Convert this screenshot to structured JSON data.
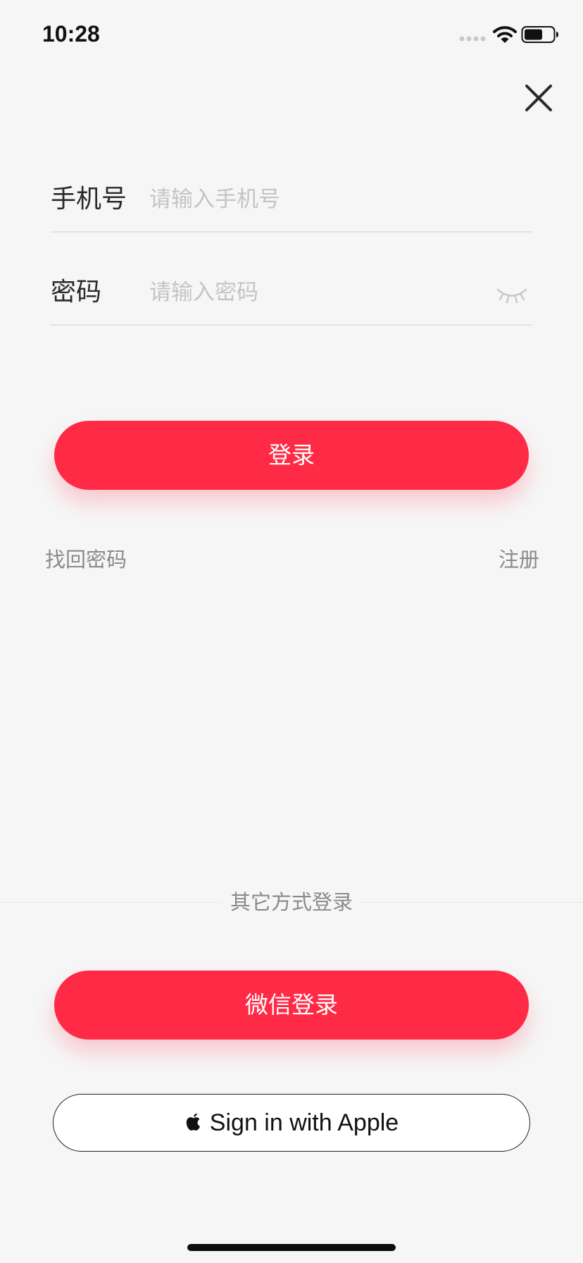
{
  "status_bar": {
    "time": "10:28"
  },
  "form": {
    "phone": {
      "label": "手机号",
      "placeholder": "请输入手机号",
      "value": ""
    },
    "password": {
      "label": "密码",
      "placeholder": "请输入密码",
      "value": ""
    }
  },
  "actions": {
    "login_label": "登录",
    "forgot_password_label": "找回密码",
    "register_label": "注册"
  },
  "alternatives": {
    "divider_label": "其它方式登录",
    "wechat_label": "微信登录",
    "apple_label": "Sign in with Apple"
  },
  "icons": {
    "close": "close-icon",
    "eye": "eye-closed-icon",
    "apple": "apple-logo-icon",
    "wifi": "wifi-icon",
    "battery": "battery-icon",
    "signal": "cellular-signal-icon"
  },
  "colors": {
    "accent": "#ff2a45",
    "background": "#f6f6f6",
    "placeholder": "#c4c4c4",
    "secondary_text": "#8a8a8a"
  }
}
